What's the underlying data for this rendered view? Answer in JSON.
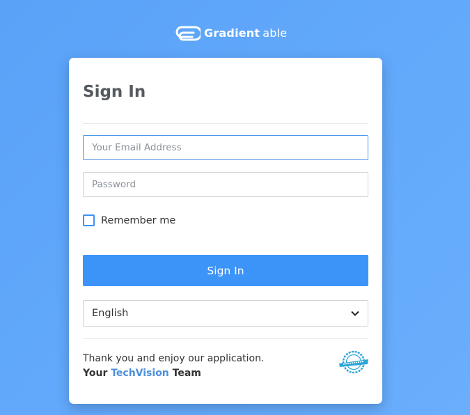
{
  "logo": {
    "strong": "Gradient",
    "light": "able"
  },
  "form": {
    "title": "Sign In",
    "email_placeholder": "Your Email Address",
    "password_placeholder": "Password",
    "remember_label": "Remember me",
    "remember_checked": false,
    "submit_label": "Sign In",
    "language": {
      "selected": "English"
    }
  },
  "footer": {
    "line1": "Thank you and enjoy our application.",
    "your": "Your",
    "brand": "TechVision",
    "team": "Team",
    "stamp_text": "TechVision"
  },
  "colors": {
    "background": "#62a9fb",
    "accent": "#3c94f8",
    "brand_text": "#4b8fde",
    "title_text": "#555a61"
  }
}
